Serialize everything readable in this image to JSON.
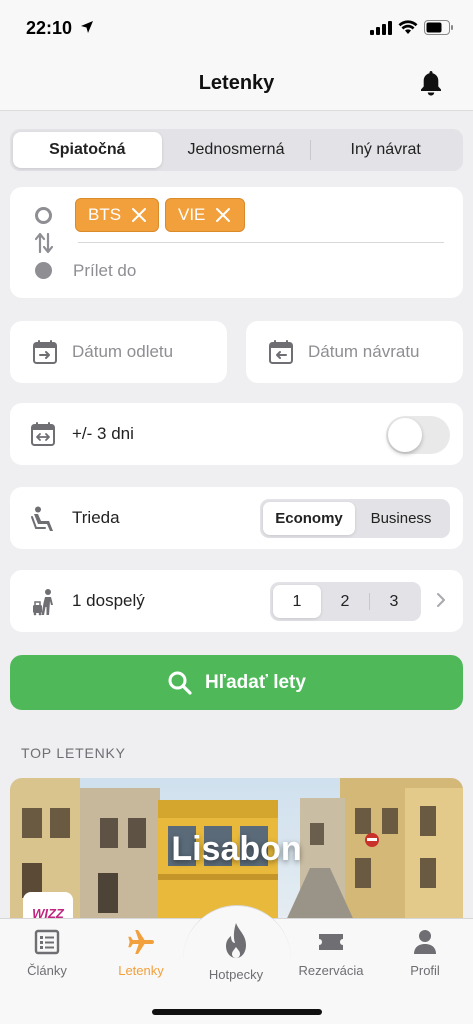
{
  "status": {
    "time": "22:10"
  },
  "header": {
    "title": "Letenky"
  },
  "trip_type": {
    "options": [
      "Spiatočná",
      "Jednosmerná",
      "Iný návrat"
    ],
    "selected": "Spiatočná"
  },
  "route": {
    "from_chips": [
      {
        "code": "BTS"
      },
      {
        "code": "VIE"
      }
    ],
    "to_placeholder": "Prílet do"
  },
  "dates": {
    "departure_placeholder": "Dátum odletu",
    "return_placeholder": "Dátum návratu"
  },
  "flex": {
    "label": "+/- 3 dni",
    "enabled": false
  },
  "travel_class": {
    "label": "Trieda",
    "options": [
      "Economy",
      "Business"
    ],
    "selected": "Economy"
  },
  "passengers": {
    "label": "1 dospelý",
    "options": [
      "1",
      "2",
      "3"
    ],
    "selected": "1"
  },
  "search": {
    "label": "Hľadať lety"
  },
  "top_section": {
    "title": "TOP LETENKY",
    "destination": {
      "city": "Lisabon",
      "airline": "WIZZ"
    }
  },
  "tabs": [
    {
      "label": "Články",
      "icon": "article-icon",
      "active": false
    },
    {
      "label": "Letenky",
      "icon": "plane-icon",
      "active": true
    },
    {
      "label": "Hotpecky",
      "icon": "flame-icon",
      "active": false
    },
    {
      "label": "Rezervácia",
      "icon": "ticket-icon",
      "active": false
    },
    {
      "label": "Profil",
      "icon": "person-icon",
      "active": false
    }
  ],
  "colors": {
    "accent": "#f2a03c",
    "search_green": "#4fb95a",
    "background": "#efeff2",
    "muted": "#8e8e93"
  }
}
